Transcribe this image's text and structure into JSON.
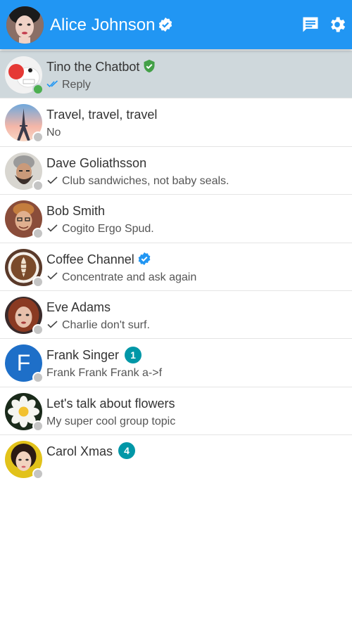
{
  "header": {
    "title": "Alice Johnson",
    "verified": true,
    "accent": "#2196f3"
  },
  "contacts": [
    {
      "name": "Tino the Chatbot",
      "preview": "Reply",
      "check": "double",
      "badge": "verified-green",
      "online": true,
      "avatar": "chatbot"
    },
    {
      "name": "Travel, travel, travel",
      "preview": "No",
      "check": "none",
      "badge": "",
      "online": false,
      "avatar": "eiffel"
    },
    {
      "name": "Dave Goliathsson",
      "preview": "Club sandwiches, not baby seals.",
      "check": "single",
      "badge": "",
      "online": false,
      "avatar": "dave"
    },
    {
      "name": "Bob Smith",
      "preview": "Cogito Ergo Spud.",
      "check": "single",
      "badge": "",
      "online": false,
      "avatar": "bob"
    },
    {
      "name": "Coffee Channel",
      "preview": "Concentrate and ask again",
      "check": "single",
      "badge": "verified-blue",
      "online": false,
      "avatar": "coffee"
    },
    {
      "name": "Eve Adams",
      "preview": "Charlie don't surf.",
      "check": "single",
      "badge": "",
      "online": false,
      "avatar": "eve"
    },
    {
      "name": "Frank Singer",
      "preview": "Frank Frank Frank a->f",
      "check": "none",
      "unread": "1",
      "online": false,
      "avatar": "letter",
      "letter": "F"
    },
    {
      "name": "Let's talk about flowers",
      "preview": "My super cool group topic",
      "check": "none",
      "badge": "",
      "online": false,
      "avatar": "flower"
    },
    {
      "name": "Carol Xmas",
      "preview": "",
      "check": "none",
      "unread": "4",
      "online": false,
      "avatar": "carol"
    }
  ]
}
